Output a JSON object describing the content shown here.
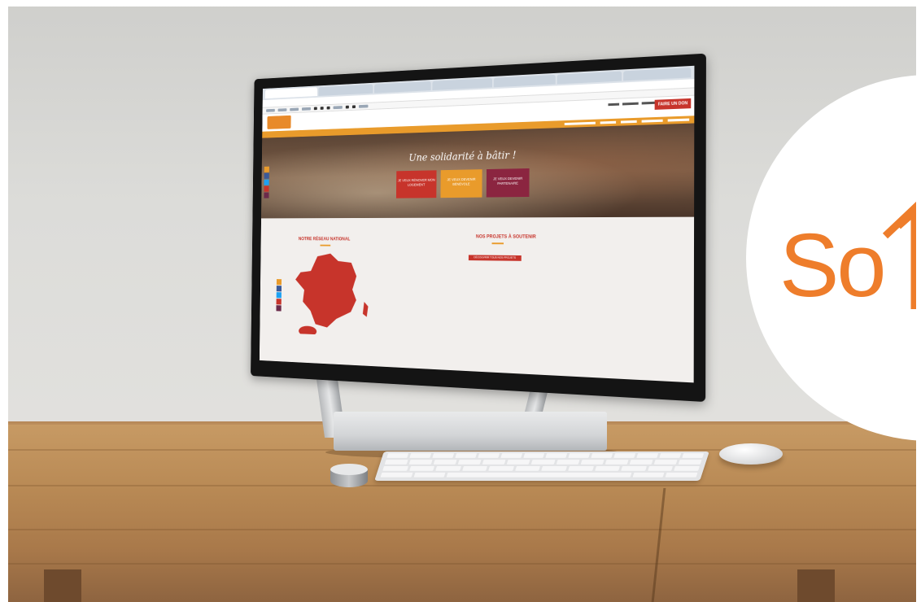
{
  "brand": {
    "logo_text": "So",
    "accent": "#ee7d2b",
    "primary_red": "#c7342b",
    "orange": "#e99b2b",
    "wine": "#8b2540"
  },
  "site": {
    "hero_title": "Une solidarité à bâtir !",
    "cta": [
      {
        "label": "JE VEUX RÉNOVER MON LOGEMENT",
        "color": "red"
      },
      {
        "label": "JE VEUX DEVENIR BÉNÉVOLE",
        "color": "orange"
      },
      {
        "label": "JE VEUX DEVENIR PARTENAIRE",
        "color": "wine"
      }
    ],
    "header_button": "FAIRE UN DON",
    "section_network": "NOTRE RÉSEAU NATIONAL",
    "section_projects": "NOS PROJETS À SOUTENIR",
    "projects_button": "DÉCOUVRIR TOUS NOS PROJETS"
  }
}
